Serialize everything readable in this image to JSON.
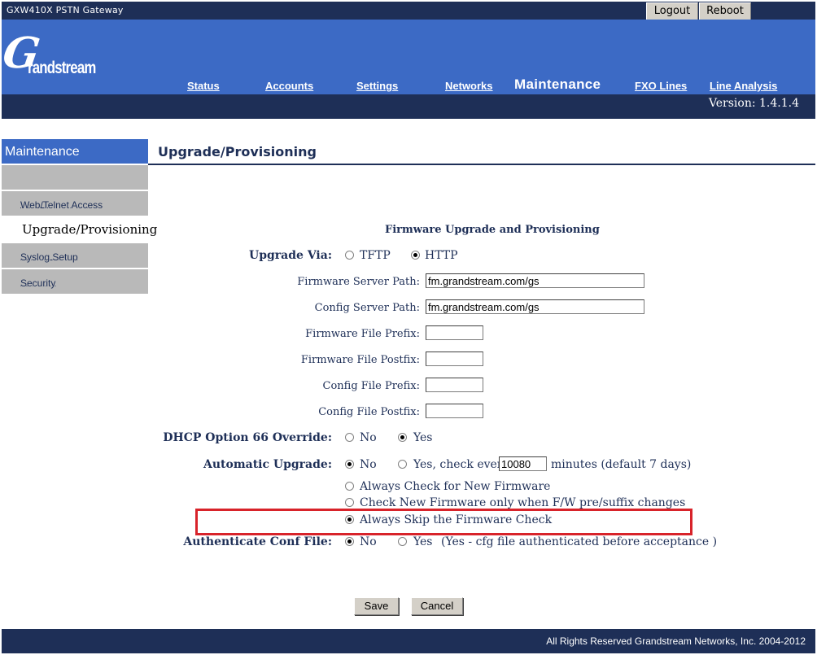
{
  "window": {
    "product": "GXW410X PSTN Gateway"
  },
  "topbar": {
    "logout": "Logout",
    "reboot": "Reboot"
  },
  "logo": {
    "initial": "G",
    "rest": "randstream"
  },
  "nav": {
    "status": "Status",
    "accounts": "Accounts",
    "settings": "Settings",
    "networks": "Networks",
    "maintenance": "Maintenance",
    "fxo_lines": "FXO Lines",
    "line_analysis": "Line Analysis"
  },
  "version": "Version: 1.4.1.4",
  "sidebar": {
    "title": "Maintenance",
    "items": [
      "Web/Telnet Access",
      "Upgrade/Provisioning",
      "Syslog Setup",
      "Security"
    ]
  },
  "page": {
    "title": "Upgrade/Provisioning"
  },
  "form": {
    "heading": "Firmware Upgrade and Provisioning",
    "upgrade_via": {
      "label": "Upgrade Via:",
      "options": [
        "TFTP",
        "HTTP"
      ],
      "selected": "HTTP"
    },
    "firmware_server_path": {
      "label": "Firmware Server Path:",
      "value": "fm.grandstream.com/gs"
    },
    "config_server_path": {
      "label": "Config Server Path:",
      "value": "fm.grandstream.com/gs"
    },
    "firmware_file_prefix": {
      "label": "Firmware File Prefix:",
      "value": ""
    },
    "firmware_file_postfix": {
      "label": "Firmware File Postfix:",
      "value": ""
    },
    "config_file_prefix": {
      "label": "Config File Prefix:",
      "value": ""
    },
    "config_file_postfix": {
      "label": "Config File Postfix:",
      "value": ""
    },
    "dhcp_override": {
      "label": "DHCP Option 66 Override:",
      "options": [
        "No",
        "Yes"
      ],
      "selected": "Yes"
    },
    "automatic_upgrade": {
      "label": "Automatic Upgrade:",
      "no": "No",
      "yes_check_every": "Yes, check every",
      "minutes_value": "10080",
      "minutes_suffix": "minutes (default 7 days)",
      "selected": "No"
    },
    "firmware_check": {
      "options": [
        "Always Check for New Firmware",
        "Check New Firmware only when F/W pre/suffix changes",
        "Always Skip the Firmware Check"
      ],
      "selected": "Always Skip the Firmware Check"
    },
    "authenticate_conf": {
      "label": "Authenticate Conf File:",
      "options": [
        "No",
        "Yes"
      ],
      "note": "(Yes - cfg file authenticated before acceptance )",
      "selected": "No"
    },
    "save": "Save",
    "cancel": "Cancel"
  },
  "footer": {
    "copyright": "All Rights Reserved Grandstream Networks, Inc. 2004-2012"
  },
  "colors": {
    "navy": "#1e2f57",
    "header_blue": "#3c6ac5",
    "sidebar_gray": "#b9b9b9",
    "highlight_red": "#d8232a"
  }
}
